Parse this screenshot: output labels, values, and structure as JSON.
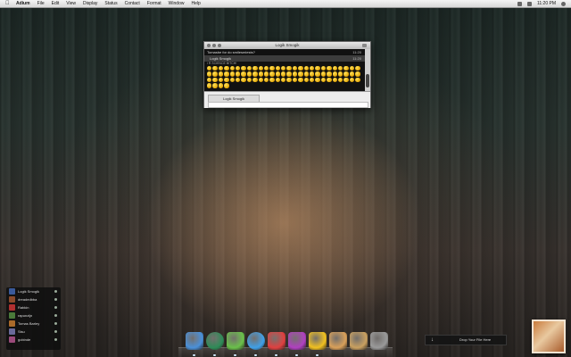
{
  "menubar": {
    "app_name": "Adium",
    "menus": [
      "File",
      "Edit",
      "View",
      "Display",
      "Status",
      "Contact",
      "Format",
      "Window",
      "Help"
    ],
    "clock": "11:20 PM"
  },
  "chat_window": {
    "title": "Logik Smogik",
    "rows": [
      {
        "text": "Tomasbe for do smilesmiests?",
        "time": "11:20"
      },
      {
        "text": "Logik Smogik",
        "time": "11:20"
      }
    ],
    "pre_text": "i R SCIENCE BITCH!",
    "smiley_count": 85,
    "input_tab": "Logik Smogik"
  },
  "buddy_list": {
    "buddies": [
      {
        "name": "Logik Smogik",
        "color": "#3a5a9a"
      },
      {
        "name": "dreadedbba",
        "color": "#8a4a2a"
      },
      {
        "name": "Rabkin",
        "color": "#b03030"
      },
      {
        "name": "rapunzijn",
        "color": "#4a7a3a"
      },
      {
        "name": "Tomas Barley",
        "color": "#aa6a2a"
      },
      {
        "name": "Sisu",
        "color": "#6a6a9a"
      },
      {
        "name": "gobinde",
        "color": "#9a4a7a"
      }
    ]
  },
  "dock": {
    "items": [
      {
        "name": "finder-icon",
        "color": "#4a90d9"
      },
      {
        "name": "globe-icon",
        "color": "#2e8b57"
      },
      {
        "name": "adium-duck-icon",
        "color": "#6ac04a"
      },
      {
        "name": "safari-icon",
        "color": "#3fa0e8"
      },
      {
        "name": "calendar-icon",
        "color": "#e04040"
      },
      {
        "name": "itunes-icon",
        "color": "#b040c0"
      },
      {
        "name": "lightbulb-icon",
        "color": "#f0c020"
      },
      {
        "name": "mail-icon",
        "color": "#d9a05a"
      },
      {
        "name": "folder-icon",
        "color": "#c9a060"
      },
      {
        "name": "trash-icon",
        "color": "#9a9a9a"
      }
    ]
  },
  "drop_zone": {
    "label": "Drop Your File Here"
  }
}
